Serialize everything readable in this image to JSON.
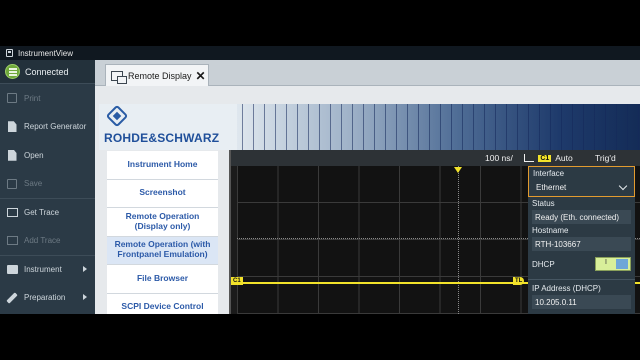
{
  "window": {
    "title": "InstrumentView"
  },
  "sidebar": {
    "status": "Connected",
    "items": [
      {
        "label": "Print",
        "enabled": false,
        "icon": "print-icon"
      },
      {
        "label": "Report Generator",
        "enabled": true,
        "icon": "report-icon"
      },
      {
        "label": "Open",
        "enabled": true,
        "icon": "open-icon"
      },
      {
        "label": "Save",
        "enabled": false,
        "icon": "save-icon"
      },
      {
        "label": "Get Trace",
        "enabled": true,
        "icon": "trace-icon"
      },
      {
        "label": "Add Trace",
        "enabled": false,
        "icon": "add-trace-icon"
      },
      {
        "label": "Instrument",
        "enabled": true,
        "icon": "instrument-icon"
      },
      {
        "label": "Preparation",
        "enabled": true,
        "icon": "pencil-icon"
      }
    ]
  },
  "tabs": [
    {
      "label": "Remote Display",
      "close": "✕"
    }
  ],
  "banner": {
    "brand": "ROHDE&SCHWARZ"
  },
  "nav": {
    "links": [
      "Instrument Home",
      "Screenshot",
      "Remote Operation (Display only)",
      "Remote Operation (with Frontpanel Emulation)",
      "File Browser",
      "SCPI Device Control"
    ]
  },
  "scope": {
    "timebase": "100 ns/",
    "channel": "C1",
    "trigger_mode": "Auto",
    "trigger_state": "Trig'd",
    "trace_marker": "C1",
    "level_marker": "TL",
    "colors": {
      "trace": "#f2e22a",
      "accent": "#e39b2f"
    }
  },
  "lan_panel": {
    "interface_label": "Interface",
    "interface_value": "Ethernet",
    "status_label": "Status",
    "status_value": "Ready (Eth. connected)",
    "hostname_label": "Hostname",
    "hostname_value": "RTH-103667",
    "dhcp_label": "DHCP",
    "dhcp_state": "I",
    "ip_label": "IP Address (DHCP)",
    "ip_value": "10.205.0.11"
  }
}
